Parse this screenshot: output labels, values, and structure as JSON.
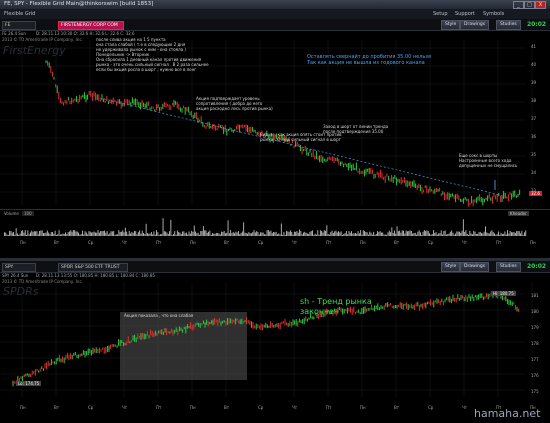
{
  "window": {
    "title": "FE, SPY - Flexible Grid Main@thinkorswim [build 1853]",
    "minimize": "_",
    "maximize": "□",
    "close": "X"
  },
  "menubar": {
    "grid_label": "Flexible Grid",
    "setup": "Setup",
    "support": "Support",
    "symbols": "Symbols"
  },
  "chart1": {
    "symbol": "FE",
    "company": "FIRSTENERGY CORP COM",
    "time": "20:02",
    "style": "Style",
    "drawings": "Drawings",
    "studies": "Studies",
    "aggregation": "FE 26.4 Sun",
    "ohlc": "D: 28.11.13 10:30   O: 32.6   H: 32.6   L: 32.6   C: 32.6",
    "copyright": "2013 © TD Ameritrade IP Company, Inc.",
    "watermark": "FirstEnergy",
    "badge_price": "32.6",
    "axis_prices": [
      "41",
      "40",
      "39",
      "38",
      "37",
      "36",
      "35",
      "34",
      "33"
    ],
    "dates": [
      "Пн",
      "Вт",
      "Ср",
      "Чт",
      "Пт",
      "Пн",
      "Вт",
      "Ср",
      "Чт",
      "Пт",
      "Пн",
      "Вт",
      "Ср",
      "Чт",
      "Пт",
      "Пн"
    ],
    "volume_label": "Volume",
    "volume_value": "100",
    "volume_badge": "Kheader",
    "annotations": {
      "note1": "после слива акция на 1 5 пункта\nона стала слабой ( т.е в следующие 2 дня\nне удерживала рынок с ним - она стояла )\nПонедельник -> Вторник\nОна сбросила 1 дневный канал против движения\nрынка - это очень сильный сигнал . В 2 раза сильнее\nесли бы акция росла в шорт , нужно все в лонг",
      "note2": "Акция подтверждает уровень\nсопротивления ( добра до него\nакция расходно лесь против рынка)",
      "note3": "Видим , как акция опять стоит против\nрынка . Очень сильный сигнал в шорт",
      "note4": "Заход в шорт от линии тренда\nпосле подтверждения 35.00",
      "note5": "Еще сокс в шорты\nНастроенные всего хода\nдопущенных не смущались",
      "note_blue": "Оставлять свернайт до пробития 35.00 нельзя\nТак как акция не вышла из годового канала"
    }
  },
  "chart2": {
    "symbol": "SPY",
    "company": "SPDR S&P 500 ETF TRUST",
    "time": "20:02",
    "style": "Style",
    "drawings": "Drawings",
    "studies": "Studies",
    "aggregation": "SPY 26.4 Sun",
    "ohlc": "D: 28.11.13 13:55   O: 180.85   H: 180.85   L: 180.84   C: 180.85",
    "copyright": "2013 © TD Ameritrade IP Company, Inc.",
    "watermark": "SPDRs",
    "high_label": "Hi: 180.75",
    "low_label": "Lo: 174.75",
    "axis_prices": [
      "181",
      "180",
      "179",
      "178",
      "177",
      "176",
      "175"
    ],
    "dates": [
      "Пн",
      "Вт",
      "Ср",
      "Чт",
      "Пт",
      "Пн",
      "Вт",
      "Ср",
      "Чт",
      "Пт",
      "Пн",
      "Вт",
      "Ср",
      "Чт",
      "Пт",
      "Пн"
    ],
    "annotation_box": "Акция показала , что она слабая",
    "trend_text": "sh - Тренд рынка\nзакончен"
  },
  "footer": {
    "watermark": "hamaha.net"
  },
  "colors": {
    "up": "#2ecc40",
    "down": "#e03131",
    "annotation_blue": "#3fa7ff",
    "time_green": "#2bd24b",
    "accent_pink": "#b3124e"
  }
}
